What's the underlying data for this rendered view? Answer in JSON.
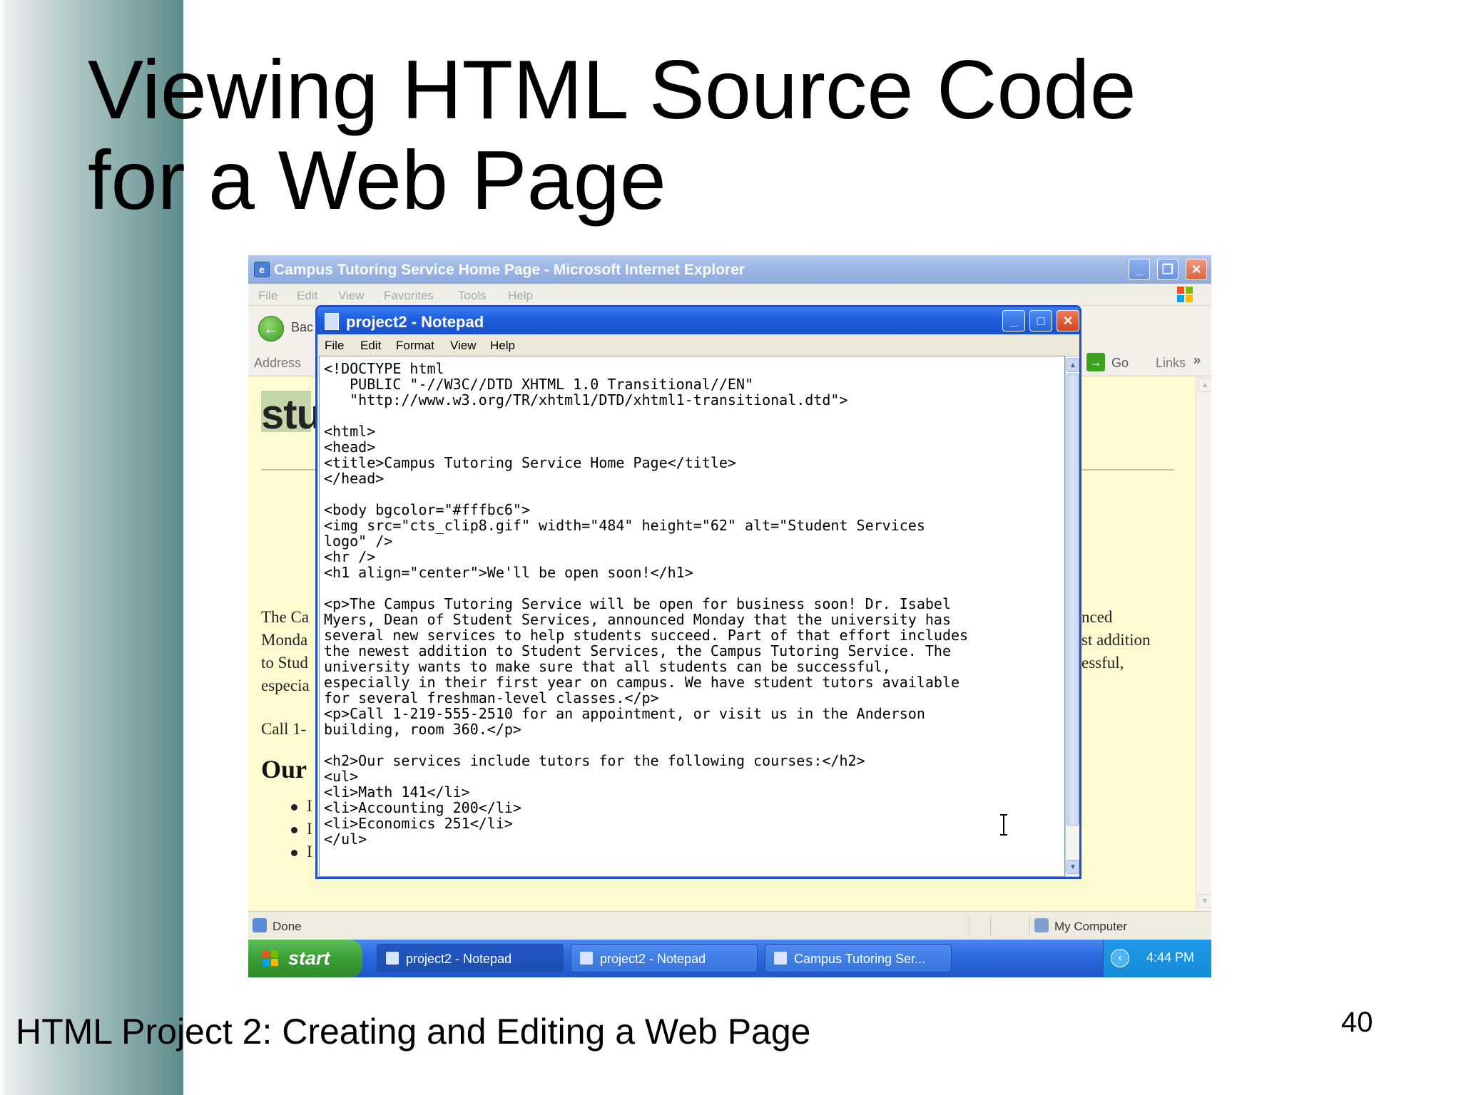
{
  "slide": {
    "title_line1": "Viewing HTML Source Code",
    "title_line2": "for a Web Page",
    "footer": "HTML Project 2: Creating and Editing a Web Page",
    "page_number": "40"
  },
  "ie_window": {
    "title": "Campus Tutoring Service Home Page - Microsoft Internet Explorer",
    "menu": [
      "File",
      "Edit",
      "View",
      "Favorites",
      "Tools",
      "Help"
    ],
    "back_label": "Bac",
    "address_label": "Address",
    "go_label": "Go",
    "links_label": "Links",
    "page_fragments": {
      "logo": "stu",
      "para_lines": [
        "The Ca",
        "Monda",
        "to Stud",
        "especia"
      ],
      "right_lines": [
        "nced",
        "st addition",
        "essful,"
      ],
      "call": "Call 1-",
      "h2": "Our",
      "bullets": [
        "I",
        "I",
        "I"
      ]
    },
    "status_text": "Done",
    "zone_text": "My Computer"
  },
  "notepad": {
    "title": "project2 - Notepad",
    "menu": [
      "File",
      "Edit",
      "Format",
      "View",
      "Help"
    ],
    "content": "<!DOCTYPE html\n   PUBLIC \"-//W3C//DTD XHTML 1.0 Transitional//EN\"\n   \"http://www.w3.org/TR/xhtml1/DTD/xhtml1-transitional.dtd\">\n\n<html>\n<head>\n<title>Campus Tutoring Service Home Page</title>\n</head>\n\n<body bgcolor=\"#fffbc6\">\n<img src=\"cts_clip8.gif\" width=\"484\" height=\"62\" alt=\"Student Services\nlogo\" />\n<hr />\n<h1 align=\"center\">We'll be open soon!</h1>\n\n<p>The Campus Tutoring Service will be open for business soon! Dr. Isabel\nMyers, Dean of Student Services, announced Monday that the university has\nseveral new services to help students succeed. Part of that effort includes\nthe newest addition to Student Services, the Campus Tutoring Service. The\nuniversity wants to make sure that all students can be successful,\nespecially in their first year on campus. We have student tutors available\nfor several freshman-level classes.</p>\n<p>Call 1-219-555-2510 for an appointment, or visit us in the Anderson\nbuilding, room 360.</p>\n\n<h2>Our services include tutors for the following courses:</h2>\n<ul>\n<li>Math 141</li>\n<li>Accounting 200</li>\n<li>Economics 251</li>\n</ul>"
  },
  "taskbar": {
    "start_label": "start",
    "tasks": [
      "project2 - Notepad",
      "project2 - Notepad",
      "Campus Tutoring Ser..."
    ],
    "clock": "4:44 PM"
  },
  "colors": {
    "side_band": "#6f9898",
    "page_bg": "#fffbd0",
    "notepad_border": "#1f4fc8",
    "taskbar": "#2c6be0"
  }
}
